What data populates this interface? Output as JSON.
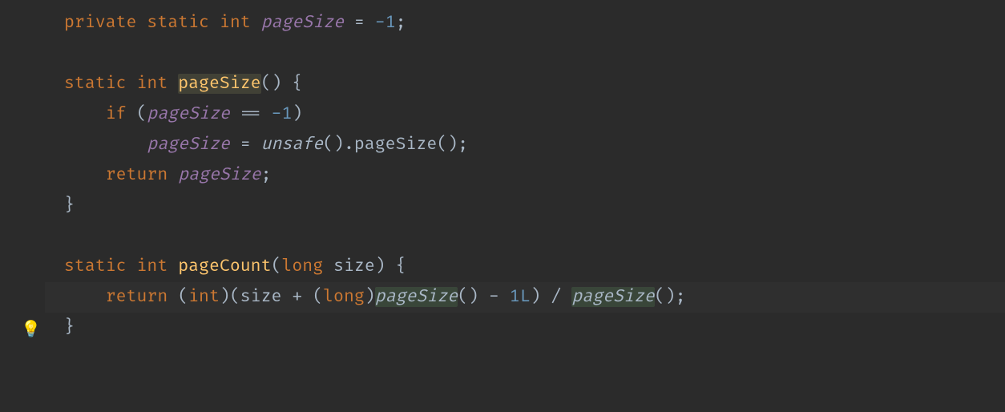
{
  "gutter": {
    "lightbulb": "💡"
  },
  "code": {
    "l1": {
      "kw1": "private",
      "kw2": "static",
      "type": "int",
      "field": "pageSize",
      "op": " = ",
      "num": "-1",
      "semi": ";"
    },
    "l3": {
      "kw1": "static",
      "type": "int",
      "ident": "pageSize",
      "rest": "() {"
    },
    "l4": {
      "kw": "if",
      "open": " (",
      "field": "pageSize",
      "op": " == ",
      "num": "-1",
      "close": ")"
    },
    "l5": {
      "field": "pageSize",
      "op": " = ",
      "call": "unsafe",
      "rest": "().pageSize();"
    },
    "l6": {
      "kw": "return",
      "sp": " ",
      "field": "pageSize",
      "semi": ";"
    },
    "l7": {
      "brace": "}"
    },
    "l9": {
      "kw1": "static",
      "type1": "int",
      "ident": "pageCount",
      "open": "(",
      "type2": "long",
      "param": " size) {"
    },
    "l10": {
      "kw": "return",
      "cast1": " (",
      "type1": "int",
      "cast1c": ")(size + (",
      "type2": "long",
      "cast2c": ")",
      "call1": "pageSize",
      "mid": "() - ",
      "num": "1L",
      "mid2": ") / ",
      "call2": "pageSize",
      "end": "();"
    },
    "l11": {
      "brace": "}"
    }
  }
}
